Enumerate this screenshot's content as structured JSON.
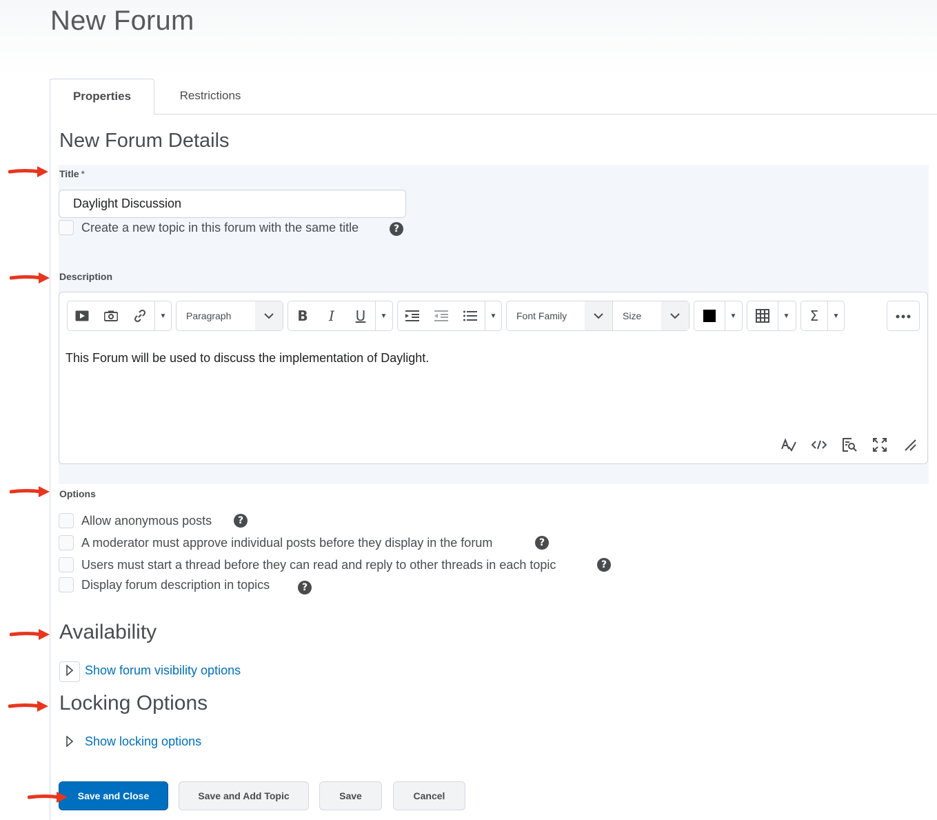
{
  "page": {
    "title": "New Forum"
  },
  "tabs": [
    {
      "label": "Properties",
      "active": true
    },
    {
      "label": "Restrictions",
      "active": false
    }
  ],
  "details": {
    "heading": "New Forum Details",
    "title_label": "Title",
    "required_mark": "*",
    "title_value": "Daylight Discussion",
    "same_title_label": "Create a new topic in this forum with the same title",
    "description_label": "Description"
  },
  "editor": {
    "paragraph_select": "Paragraph",
    "font_family_select": "Font Family",
    "size_select": "Size",
    "text_color": "#000000",
    "content": "This Forum will be used to discuss the implementation of Daylight."
  },
  "options": {
    "label": "Options",
    "items": [
      {
        "label": "Allow anonymous posts",
        "checked": false
      },
      {
        "label": "A moderator must approve individual posts before they display in the forum",
        "checked": false
      },
      {
        "label": "Users must start a thread before they can read and reply to other threads in each topic",
        "checked": false
      },
      {
        "label": "Display forum description in topics",
        "checked": false
      }
    ]
  },
  "availability": {
    "heading": "Availability",
    "link": "Show forum visibility options"
  },
  "locking": {
    "heading": "Locking Options",
    "link": "Show locking options"
  },
  "buttons": {
    "save_close": "Save and Close",
    "save_add_topic": "Save and Add Topic",
    "save": "Save",
    "cancel": "Cancel"
  },
  "colors": {
    "primary": "#006fbf",
    "link": "#006fbf",
    "annotation_arrow": "#e8361e",
    "highlight": "#f3f7fc"
  },
  "help_glyph": "?"
}
